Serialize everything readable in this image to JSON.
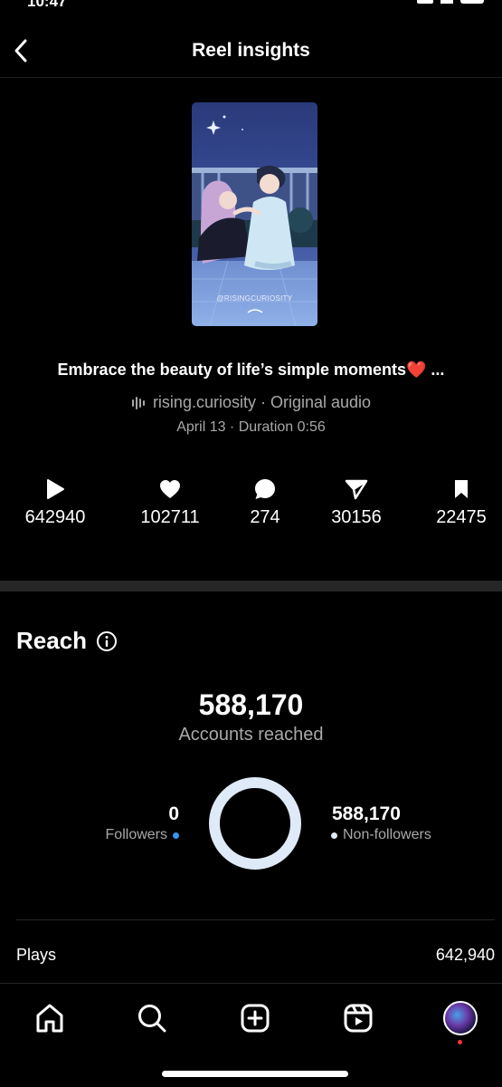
{
  "status": {
    "time": "10:47"
  },
  "header": {
    "title": "Reel insights"
  },
  "reel": {
    "watermark": "@RISINGCURIOSITY",
    "caption": "Embrace the beauty of life’s simple moments",
    "caption_emoji": "❤️",
    "caption_ellipsis": " ...",
    "account": "rising.curiosity",
    "audio": " · Original audio",
    "date_line": "April 13 · Duration 0:56"
  },
  "stats": {
    "plays": "642940",
    "likes": "102711",
    "comments": "274",
    "shares": "30156",
    "saves": "22475"
  },
  "reach": {
    "title": "Reach",
    "accounts_reached": "588,170",
    "accounts_reached_label": "Accounts reached",
    "followers_value": "0",
    "followers_label": "Followers",
    "non_followers_value": "588,170",
    "non_followers_label": "Non-followers",
    "followers_share": 0,
    "non_followers_share": 1,
    "colors": {
      "followers": "#3797f0",
      "non_followers": "#dfeaf8"
    }
  },
  "plays_row": {
    "label": "Plays",
    "value": "642,940"
  },
  "tabbar": {
    "icons": [
      "home-icon",
      "search-icon",
      "create-icon",
      "reels-icon",
      "profile-avatar"
    ]
  }
}
